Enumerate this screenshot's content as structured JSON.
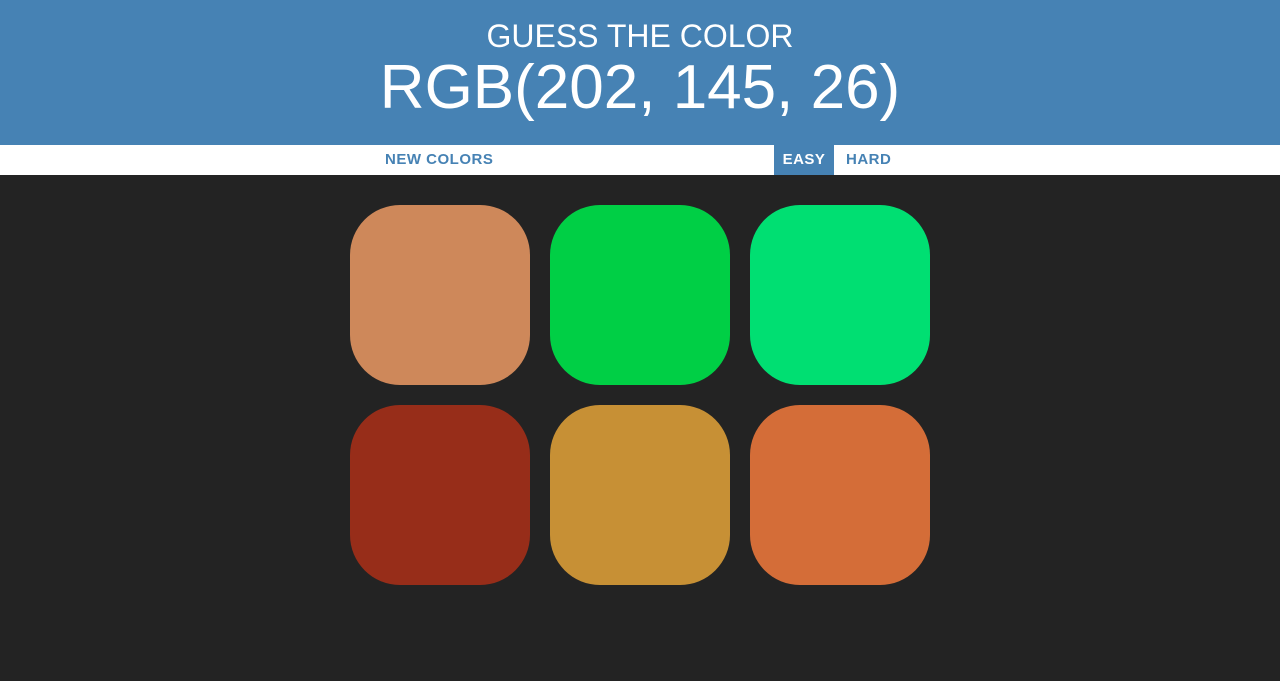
{
  "header": {
    "line1": "GUESS THE COLOR",
    "line2": "RGB(202, 145, 26)",
    "background": "#4682b4"
  },
  "controls": {
    "reset_label": "NEW COLORS",
    "easy_label": "EASY",
    "hard_label": "HARD",
    "selected_mode": "EASY"
  },
  "squares": [
    {
      "color": "#ce885a"
    },
    {
      "color": "#00cf45"
    },
    {
      "color": "#00df72"
    },
    {
      "color": "#972d19"
    },
    {
      "color": "#c79035"
    },
    {
      "color": "#d46d38"
    }
  ]
}
